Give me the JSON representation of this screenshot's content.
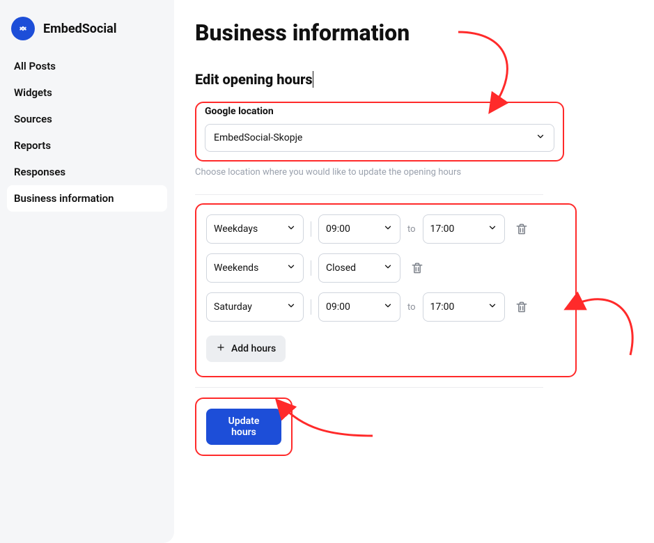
{
  "brand": {
    "name": "EmbedSocial"
  },
  "sidebar": {
    "items": [
      {
        "label": "All Posts"
      },
      {
        "label": "Widgets"
      },
      {
        "label": "Sources"
      },
      {
        "label": "Reports"
      },
      {
        "label": "Responses"
      },
      {
        "label": "Business information",
        "active": true
      }
    ]
  },
  "page": {
    "title": "Business information",
    "subtitle": "Edit opening hours"
  },
  "location": {
    "label": "Google location",
    "selected": "EmbedSocial-Skopje",
    "helper": "Choose location where you would like to update the opening hours"
  },
  "hours": {
    "rows": [
      {
        "days": "Weekdays",
        "open": "09:00",
        "to": "to",
        "close": "17:00"
      },
      {
        "days": "Weekends",
        "closed_label": "Closed"
      },
      {
        "days": "Saturday",
        "open": "09:00",
        "to": "to",
        "close": "17:00"
      }
    ],
    "add_label": "Add hours"
  },
  "actions": {
    "update_label": "Update hours"
  },
  "colors": {
    "primary": "#1d4ed8",
    "annotation": "#ff2a2a",
    "border": "#d0d5dd",
    "muted": "#9aa1ad"
  }
}
